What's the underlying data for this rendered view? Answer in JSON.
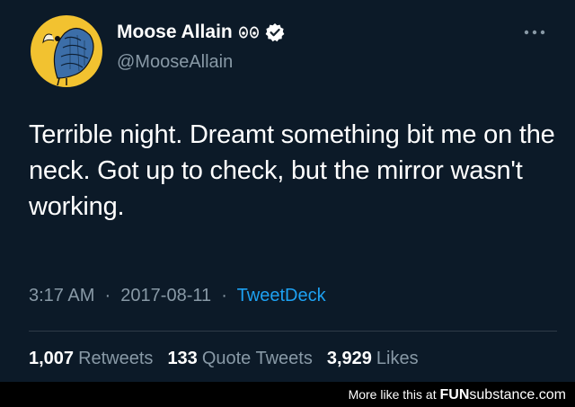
{
  "tweet": {
    "display_name": "Moose Allain",
    "name_emoji": "eyes-icon",
    "verified": "verified-badge-icon",
    "handle": "@MooseAllain",
    "more_label": "•••",
    "text": "Terrible night. Dreamt something bit me on the neck. Got up to check, but the mirror wasn't working.",
    "time": "3:17 AM",
    "date": "2017-08-11",
    "separator": "·",
    "source": "TweetDeck",
    "stats": {
      "retweets_count": "1,007",
      "retweets_label": "Retweets",
      "quotes_count": "133",
      "quotes_label": "Quote Tweets",
      "likes_count": "3,929",
      "likes_label": "Likes"
    }
  },
  "footer": {
    "prefix": "More like this at ",
    "brand_bold": "FUN",
    "brand_rest": "substance.com"
  },
  "colors": {
    "background": "#0c1a28",
    "accent": "#1da1f2",
    "muted": "#8899a6",
    "avatar_bg": "#f2c230"
  }
}
